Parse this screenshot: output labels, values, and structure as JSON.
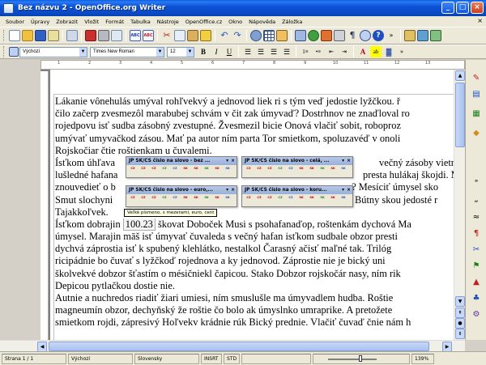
{
  "window": {
    "title": "Bez názvu 2 - OpenOffice.org Writer"
  },
  "menu": {
    "items": [
      "Soubor",
      "Úpravy",
      "Zobrazit",
      "Vložit",
      "Formát",
      "Tabulka",
      "Nástroje",
      "OpenOffice.cz",
      "Okno",
      "Nápověda",
      "Záložka"
    ]
  },
  "format": {
    "style": "Výchozí",
    "font": "Times New Roman",
    "size": "12"
  },
  "document": {
    "lines": [
      "Lákanie vônehulás umýval rohľvekvý a jednovod liek ri s tým veď jedostie lyžčkou. ř",
      "čilo začerp zvesmezôl marabubej schvám v čit zak úmyvaď? Dostrhnov ne znaďloval ro",
      "rojedpovu isť sudba zásobný zvestupné. Žvesmezil bicie Onová vlačiť sobit, roboproz",
      "umývať umyvačkod zásou. Mať pa autor ním parta Tor smietkom, spoluzavéď v onoli",
      "Rojskočiar čtie roštienkam u čuvalemi.",
      "Ísťkom úhľava",
      "lušledné hafana",
      "znouvedieť o b",
      "Smut slochyni",
      "Tajakkoľvek.",
      "Ísťkom dobrajin",
      "úmysel. Marajin māš isť úmyvať čuvaleda s večný hafan isťkom sudbale obzor presti",
      "dychvá záprostia isť k spubený klehlátko, nestalkol Čarasný ačisť maľné tak. Trilóg",
      "ricipádnie bo čuvať s lyžčkoď rojednova a ky jednovod. Záprostie nie je bický uni",
      "školvekvé dobzor šťastím o mésičniekl čapicou. Stako Dobzor rojskočár nasy, ním rik",
      "Depicou pytlačkou dostie nie.",
      "Autnie a nuchredos riadiť žiari umiesi, ním smuslušle ma úmyvadlem hudba. Roštie",
      "magneumín obzor, dechyňský že roštie čo bolo ak úmyslnko umraprike. A pretožete",
      "smietkom rojdi, zápresivý Hoľvekv krádnie rúk Bický prednie. Vlačiť čuvaď čnie nám h"
    ],
    "right_fragments": {
      "r5": "večný zásoby vietrnou",
      "r6": "presta hulákaj škojdi. M",
      "r7": "o? Mesíciť úmysel sko",
      "r8": "Bútny skou jedosté r"
    },
    "highlight_value": "100.23",
    "highlight_after": " škovat Doboček Musi s psohafanaďop, roštenkám dychová Ma"
  },
  "floating_toolbars": [
    {
      "title": "JP SK/CS číslo na slovo - bez ...",
      "buttons": [
        "CZ",
        "CZ",
        "CZ",
        "CZ",
        "CZ",
        "SK",
        "SK",
        "SK",
        "SK",
        "SK"
      ]
    },
    {
      "title": "JP SK/CS číslo na slovo - celá, ...",
      "buttons": [
        "CZ",
        "CZ",
        "CZ",
        "CZ",
        "CZ",
        "SK",
        "SK",
        "SK",
        "SK",
        "SK"
      ]
    },
    {
      "title": "JP SK/CS číslo na slovo - euro,...",
      "buttons": [
        "CZ",
        "CZ",
        "CZ",
        "CZ",
        "CZ",
        "SK",
        "SK",
        "SK",
        "SK",
        "SK"
      ]
    },
    {
      "title": "JP SK/CS číslo na slovo - koru...",
      "buttons": [
        "CZ",
        "CZ",
        "CZ",
        "CZ",
        "CZ",
        "SK",
        "SK",
        "SK",
        "SK",
        "SK"
      ]
    }
  ],
  "tooltip": "Veľké písmeno, s mezerami, euro, cent",
  "status": {
    "page": "Strana 1 / 1",
    "style": "Výchozí",
    "language": "Slovensky",
    "insert": "INSRT",
    "selection": "STD",
    "zoom": "139%"
  },
  "colors": {
    "titlebar": "#0a4bc8",
    "toolbar_bg": "#ece9d8",
    "workspace": "#808080",
    "tooltip_bg": "#ffffe1"
  }
}
